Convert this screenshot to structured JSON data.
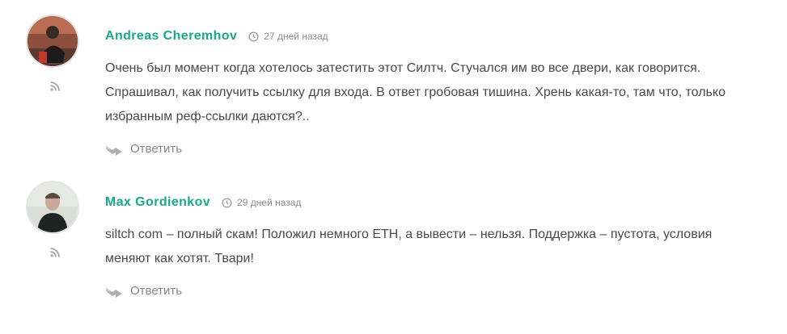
{
  "comments": [
    {
      "author": "Andreas Cheremhov",
      "time": "27 дней назад",
      "text": "Очень был момент когда хотелось затестить этот Силтч. Стучался им во все двери, как говорится. Спрашивал, как получить ссылку для входа. В ответ гробовая тишина. Хрень какая-то, там что, только избранным реф-ссылки даются?..",
      "reply_label": "Ответить"
    },
    {
      "author": "Max Gordienkov",
      "time": "29 дней назад",
      "text": "siltch com – полный скам! Положил немного ETH, а вывести – нельзя. Поддержка – пустота, условия меняют как хотят. Твари!",
      "reply_label": "Ответить"
    }
  ],
  "colors": {
    "author": "#1aa78a",
    "text": "#4a4a4a",
    "muted": "#8d8d8d"
  },
  "icons": {
    "time": "clock-icon",
    "rss": "rss-icon",
    "reply": "reply-arrow-icon"
  }
}
